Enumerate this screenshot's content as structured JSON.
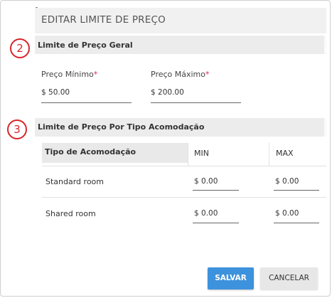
{
  "dialog": {
    "title": "EDITAR LIMITE DE PREÇO"
  },
  "general": {
    "marker": "2",
    "section_title": "Limite de Preço Geral",
    "min_label": "Preço Mínimo",
    "max_label": "Preço Máximo",
    "required_mark": "*",
    "min_value": "$ 50.00",
    "max_value": "$ 200.00"
  },
  "by_type": {
    "marker": "3",
    "section_title": "Limite de Preço Por Tipo Acomodação",
    "columns": [
      "Tipo de Acomodação",
      "MIN",
      "MAX"
    ],
    "rows": [
      {
        "type": "Standard room",
        "min": "$ 0.00",
        "max": "$ 0.00"
      },
      {
        "type": "Shared room",
        "min": "$ 0.00",
        "max": "$ 0.00"
      }
    ]
  },
  "buttons": {
    "save": "SALVAR",
    "cancel": "CANCELAR"
  },
  "colors": {
    "accent": "#3d92dd",
    "marker": "#d8262a",
    "required": "#e8204e"
  }
}
